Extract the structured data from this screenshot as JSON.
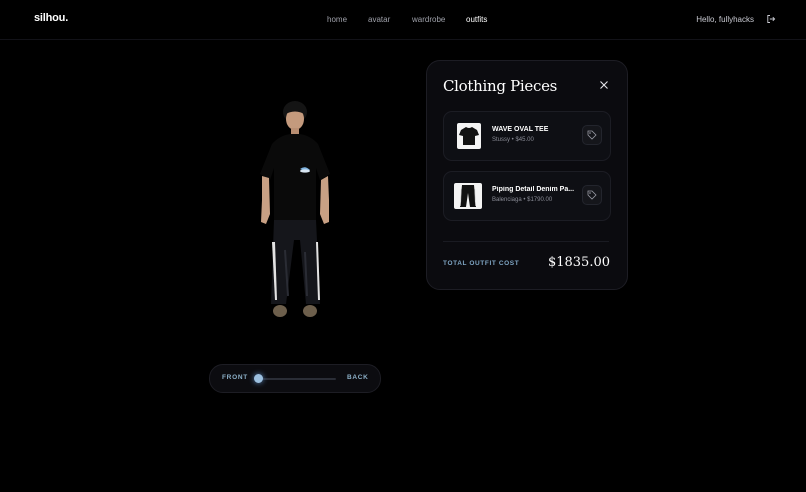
{
  "header": {
    "logo": "silhou.",
    "nav": [
      {
        "label": "home",
        "active": false
      },
      {
        "label": "avatar",
        "active": false
      },
      {
        "label": "wardrobe",
        "active": false
      },
      {
        "label": "outfits",
        "active": true
      }
    ],
    "greeting": "Hello, fullyhacks",
    "logout_icon": "logout-icon"
  },
  "viewer": {
    "front_label": "FRONT",
    "back_label": "BACK",
    "rotation_fraction": 0.0
  },
  "panel": {
    "title": "Clothing Pieces",
    "close_icon": "close-icon",
    "items": [
      {
        "name": "WAVE OVAL TEE",
        "meta": "Stussy • $45.00",
        "icon": "tshirt-icon"
      },
      {
        "name": "Piping Detail Denim Pa...",
        "meta": "Balenciaga • $1790.00",
        "icon": "pants-icon"
      }
    ],
    "total_label": "TOTAL OUTFIT COST",
    "total_value": "$1835.00"
  },
  "colors": {
    "background": "#000000",
    "panel": "#0b0b0f",
    "accent": "#8cb0c8",
    "slider_knob": "#9cc0e0"
  }
}
